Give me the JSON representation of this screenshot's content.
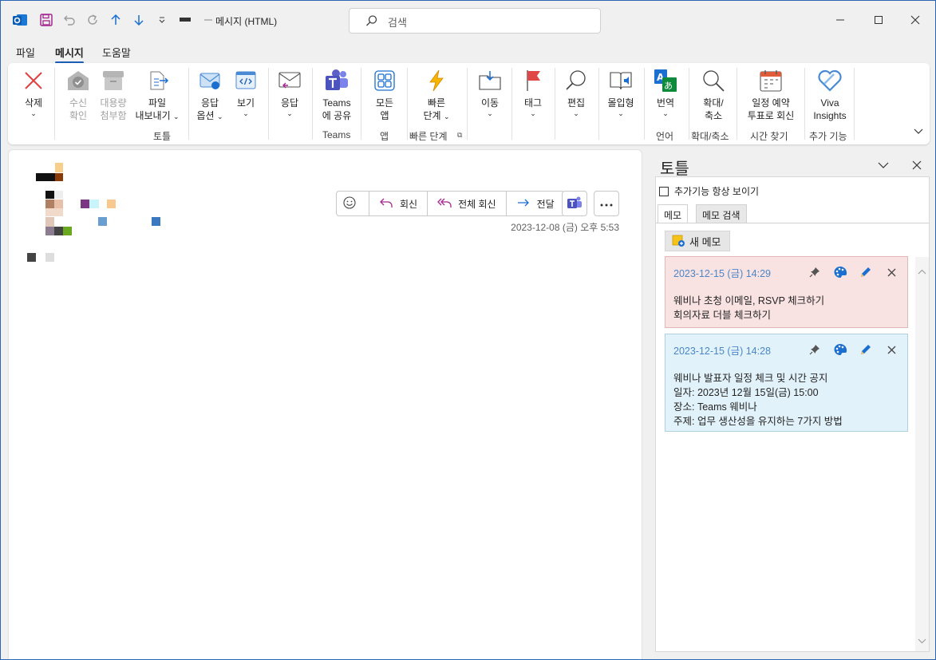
{
  "titlebar": {
    "title": "메시지 (HTML)",
    "search_placeholder": "검색"
  },
  "menu": {
    "tabs": [
      {
        "label": "파일"
      },
      {
        "label": "메시지"
      },
      {
        "label": "도움말"
      }
    ]
  },
  "ribbon": {
    "delete": "삭제",
    "receipt": [
      "수신",
      "확인"
    ],
    "large_attach": [
      "대용량",
      "첨부함"
    ],
    "export": [
      "파일",
      "내보내기"
    ],
    "reply_options": [
      "응답",
      "옵션"
    ],
    "view": "보기",
    "respond": "응답",
    "teams_share": [
      "Teams",
      "에 공유"
    ],
    "all_apps": [
      "모든",
      "앱"
    ],
    "quick_steps": [
      "빠른",
      "단계"
    ],
    "move": "이동",
    "tags": "태그",
    "editing": "편집",
    "immersive": "몰입형",
    "translate": "번역",
    "zoom": [
      "확대/",
      "축소"
    ],
    "schedule": [
      "일정 예약",
      "투표로 회신"
    ],
    "viva": [
      "Viva",
      "Insights"
    ],
    "groups": {
      "totle": "토틀",
      "teams": "Teams",
      "apps": "앱",
      "quick_steps": "빠른 단계",
      "language": "언어",
      "zoom": "확대/축소",
      "find_time": "시간 찾기",
      "addins": "추가 기능"
    }
  },
  "message": {
    "actions": {
      "reply": "회신",
      "reply_all": "전체 회신",
      "forward": "전달"
    },
    "date": "2023-12-08 (금) 오후 5:53"
  },
  "sidepane": {
    "title": "토틀",
    "always_show": "추가기능 항상 보이기",
    "tabs": [
      {
        "label": "메모"
      },
      {
        "label": "메모 검색"
      }
    ],
    "new_memo": "새 메모",
    "memos": [
      {
        "date": "2023-12-15 (금) 14:29",
        "color": "#f9e2e2",
        "lines": [
          "웨비나 초청 이메일, RSVP 체크하기",
          "회의자료 더블 체크하기"
        ]
      },
      {
        "date": "2023-12-15 (금) 14:28",
        "color": "#e2f2fa",
        "lines": [
          "웨비나 발표자 일정 체크 및 시간 공지",
          "일자: 2023년 12월 15일(금) 15:00",
          "장소: Teams 웨비나",
          "주제: 업무 생산성을 유지하는 7가지 방법"
        ]
      }
    ]
  },
  "colors": {
    "accent": "#1a5fb4",
    "delete_red": "#e04040",
    "teams_purple": "#5b5fc7"
  }
}
